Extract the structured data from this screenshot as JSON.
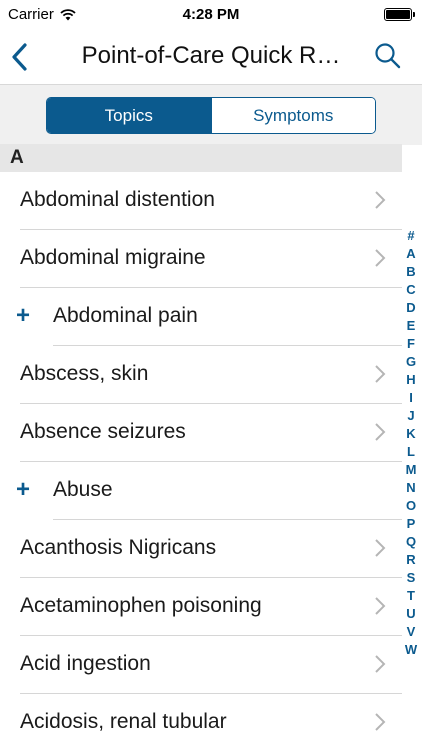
{
  "status_bar": {
    "carrier": "Carrier",
    "time": "4:28 PM"
  },
  "nav": {
    "title": "Point-of-Care Quick R…",
    "back_icon": "chevron-left-icon",
    "search_icon": "search-icon"
  },
  "segment": {
    "topics_label": "Topics",
    "symptoms_label": "Symptoms",
    "selected": "Topics"
  },
  "section": {
    "header": "A"
  },
  "items": [
    {
      "label": "Abdominal distention",
      "expandable": false
    },
    {
      "label": "Abdominal migraine",
      "expandable": false
    },
    {
      "label": "Abdominal pain",
      "expandable": true
    },
    {
      "label": "Abscess, skin",
      "expandable": false
    },
    {
      "label": "Absence seizures",
      "expandable": false
    },
    {
      "label": "Abuse",
      "expandable": true
    },
    {
      "label": "Acanthosis Nigricans",
      "expandable": false
    },
    {
      "label": "Acetaminophen poisoning",
      "expandable": false
    },
    {
      "label": "Acid ingestion",
      "expandable": false
    },
    {
      "label": "Acidosis, renal tubular",
      "expandable": false
    }
  ],
  "plus_symbol": "+",
  "index_letters": [
    "#",
    "A",
    "B",
    "C",
    "D",
    "E",
    "F",
    "G",
    "H",
    "I",
    "J",
    "K",
    "L",
    "M",
    "N",
    "O",
    "P",
    "Q",
    "R",
    "S",
    "T",
    "U",
    "V",
    "W"
  ],
  "colors": {
    "accent": "#0b5a8e",
    "section_bg": "#e6e6e6",
    "segment_bg": "#f0f0f0"
  }
}
